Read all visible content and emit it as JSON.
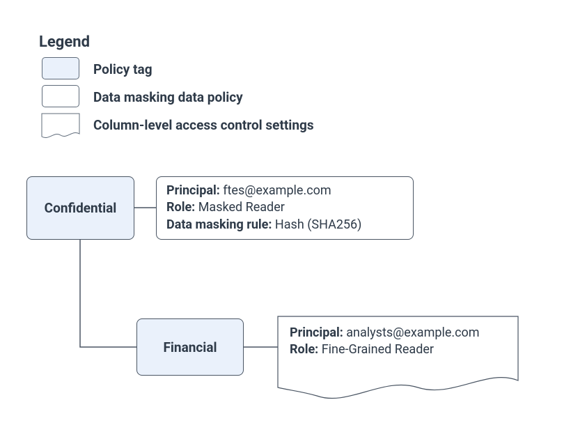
{
  "legend": {
    "title": "Legend",
    "items": [
      {
        "kind": "policy-tag",
        "label": "Policy tag"
      },
      {
        "kind": "masking-policy",
        "label": "Data masking data policy"
      },
      {
        "kind": "clac-settings",
        "label": "Column-level access control settings"
      }
    ]
  },
  "nodes": {
    "confidential": {
      "type": "policy-tag",
      "name": "Confidential",
      "masking_policy": {
        "principal_label": "Principal:",
        "principal_value": "ftes@example.com",
        "role_label": "Role:",
        "role_value": "Masked Reader",
        "rule_label": "Data masking rule:",
        "rule_value": "Hash (SHA256)"
      }
    },
    "financial": {
      "type": "policy-tag",
      "name": "Financial",
      "parent": "confidential",
      "clac": {
        "principal_label": "Principal:",
        "principal_value": "analysts@example.com",
        "role_label": "Role:",
        "role_value": "Fine-Grained Reader"
      }
    }
  }
}
